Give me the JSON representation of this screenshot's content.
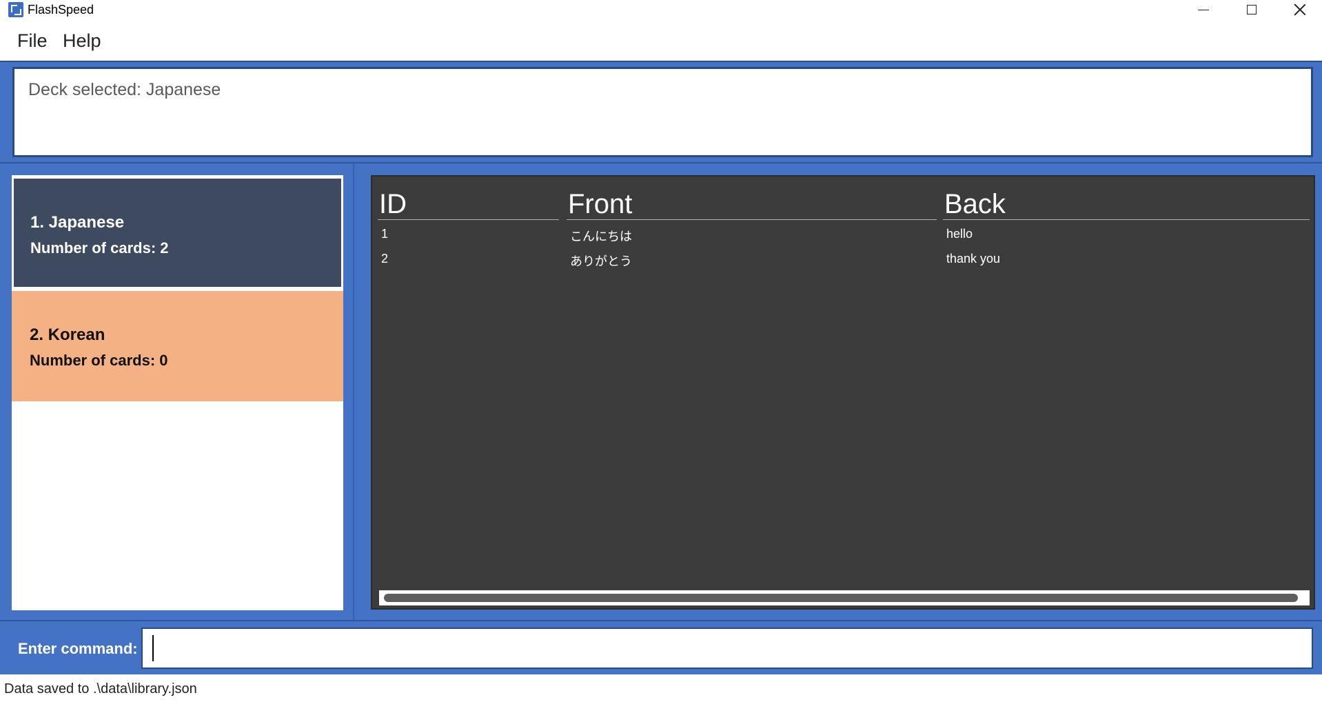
{
  "window": {
    "title": "FlashSpeed"
  },
  "menu": {
    "items": [
      {
        "label": "File"
      },
      {
        "label": "Help"
      }
    ]
  },
  "result": {
    "text": "Deck selected: Japanese"
  },
  "decks": [
    {
      "name": "1.  Japanese",
      "count": "Number of cards: 2",
      "selected": true
    },
    {
      "name": "2.  Korean",
      "count": "Number of cards: 0",
      "selected": false
    }
  ],
  "cards_table": {
    "headers": [
      "ID",
      "Front",
      "Back"
    ],
    "rows": [
      {
        "id": "1",
        "front": "こんにちは",
        "back": "hello"
      },
      {
        "id": "2",
        "front": "ありがとう",
        "back": "thank you"
      }
    ]
  },
  "command": {
    "label": "Enter command:",
    "value": "",
    "placeholder": ""
  },
  "status": {
    "text": "Data saved to .\\data\\library.json"
  },
  "colors": {
    "frame_blue": "#4472c4",
    "selected_deck": "#3e4a5f",
    "other_deck": "#f4b183",
    "table_bg": "#3c3c3c"
  },
  "icons": {
    "app": "flashspeed-app-icon",
    "minimize": "minimize-icon",
    "maximize": "maximize-icon",
    "close": "close-icon"
  }
}
